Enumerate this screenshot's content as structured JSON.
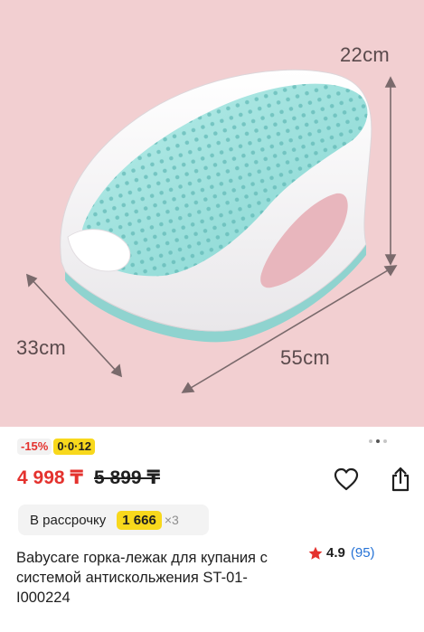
{
  "product_image": {
    "alt": "Babycare bath seat",
    "dimensions": {
      "height": "22cm",
      "depth": "33cm",
      "width": "55cm"
    }
  },
  "badges": {
    "discount": "-15%",
    "installment": "0·0·12"
  },
  "carousel": {
    "count": 3,
    "active": 2
  },
  "price": {
    "current": "4 998 ₸",
    "old": "5 899 ₸"
  },
  "installment": {
    "label": "В рассрочку",
    "amount": "1 666",
    "multiplier": "×3"
  },
  "product": {
    "title": "Babycare горка-лежак для купания с системой антискольжения ST-01-I000224"
  },
  "rating": {
    "value": "4.9",
    "count": "(95)"
  },
  "colors": {
    "accent_red": "#e4322e",
    "installment_yellow": "#f8d81c",
    "link_blue": "#2673d6",
    "hero_pink": "#f2cfd1"
  }
}
